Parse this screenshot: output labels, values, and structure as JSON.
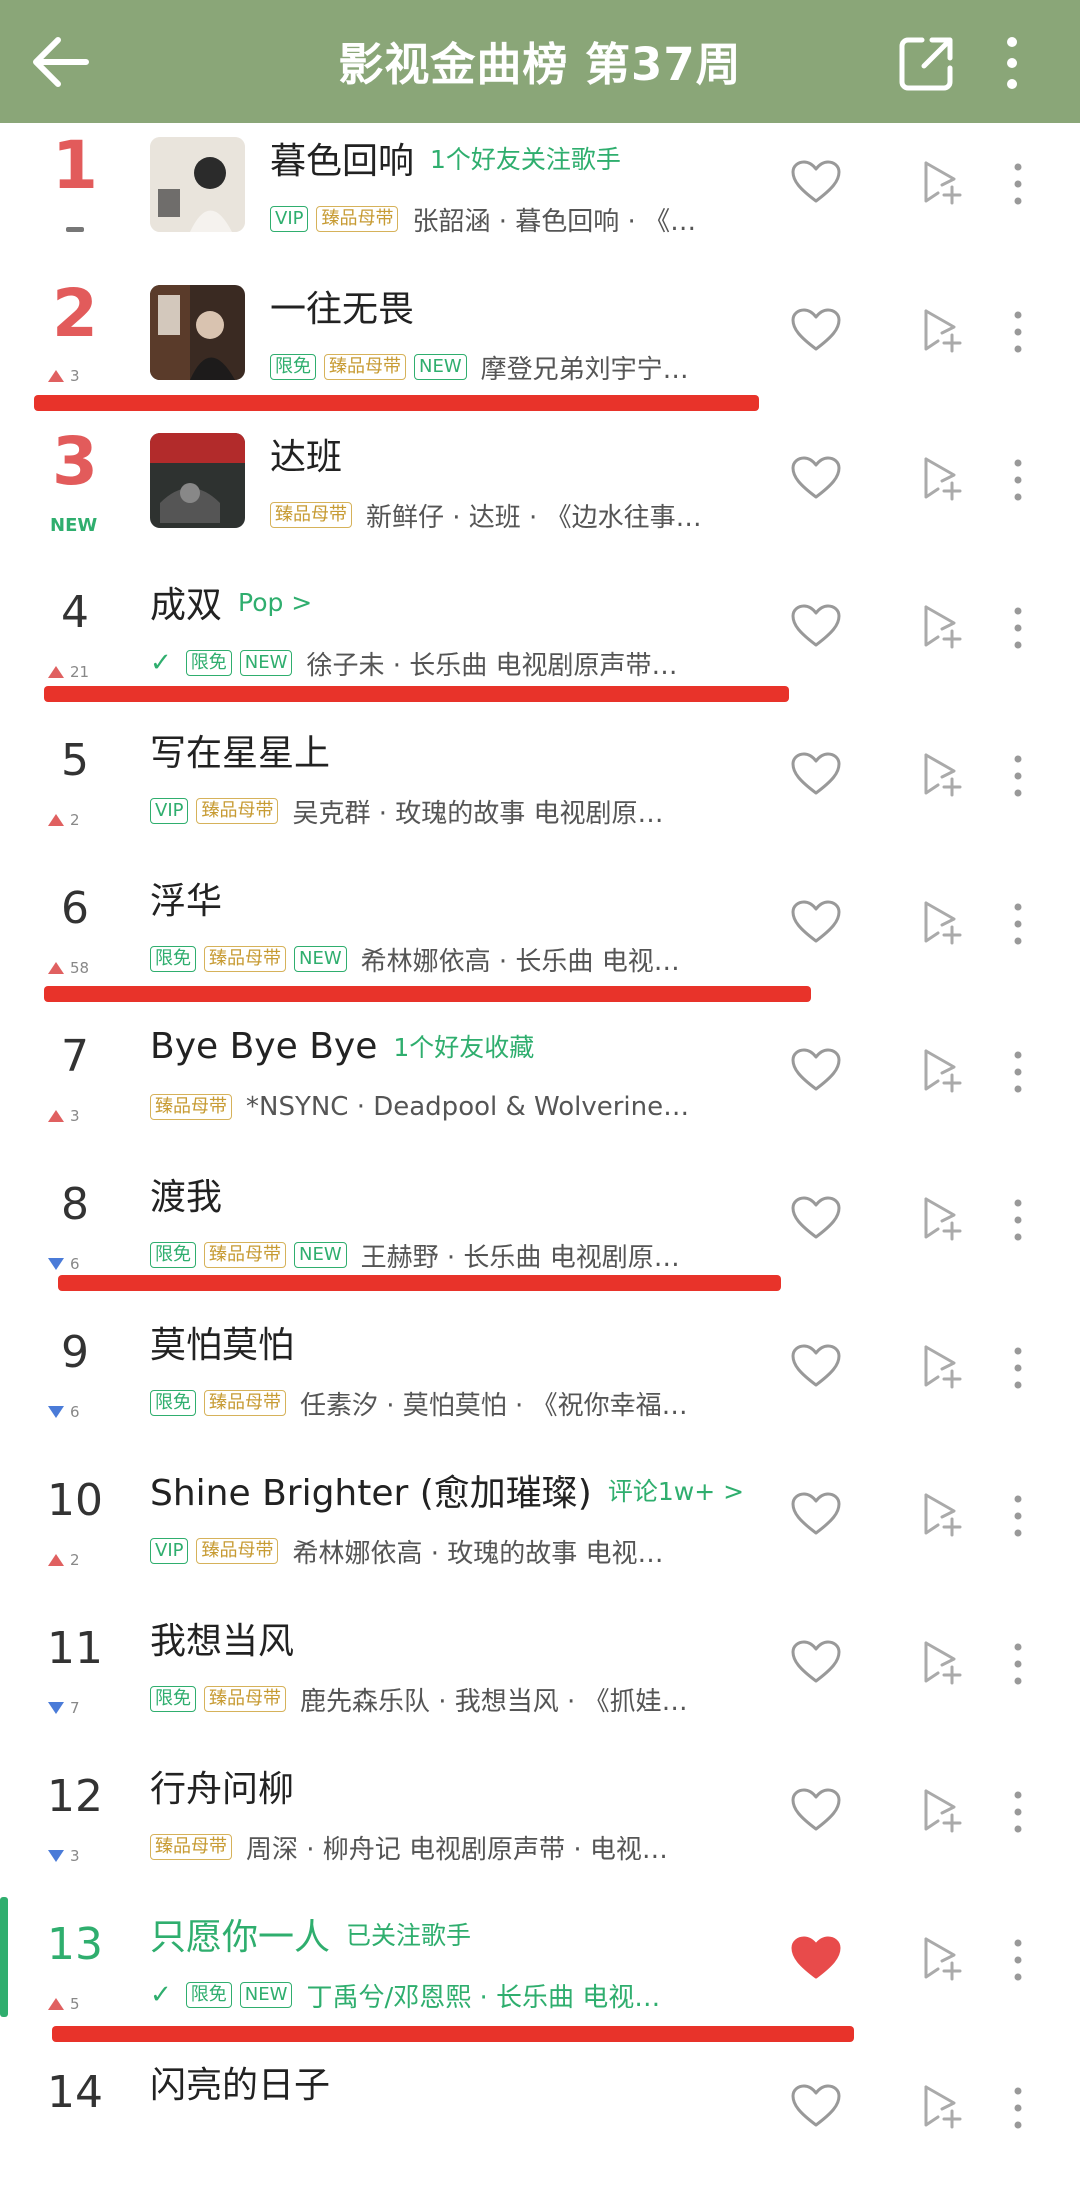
{
  "header": {
    "title": "影视金曲榜 第37周",
    "background_color": "#8aa678"
  },
  "rows": [
    {
      "rank": "1",
      "trend": "same",
      "trend_num": "",
      "title": "暮色回响",
      "tagline": "1个好友关注歌手",
      "badges": [
        "VIP",
        "臻品母带"
      ],
      "meta": "张韶涵 · 暮色回响 · 《…",
      "cover": true,
      "liked": false,
      "highlight": false
    },
    {
      "rank": "2",
      "trend": "up",
      "trend_num": "3",
      "title": "一往无畏",
      "tagline": "",
      "badges": [
        "限免",
        "臻品母带",
        "NEW"
      ],
      "meta": "摩登兄弟刘宇宁…",
      "cover": true,
      "liked": false,
      "highlight": false
    },
    {
      "rank": "3",
      "trend": "new",
      "trend_num": "NEW",
      "title": "达班",
      "tagline": "",
      "badges": [
        "臻品母带"
      ],
      "meta": "新鲜仔 · 达班 · 《边水往事…",
      "cover": true,
      "liked": false,
      "highlight": false
    },
    {
      "rank": "4",
      "trend": "up",
      "trend_num": "21",
      "title": "成双",
      "tagline": "Pop >",
      "badges": [
        "check",
        "限免",
        "NEW"
      ],
      "meta": "徐子未 · 长乐曲 电视剧原声带…",
      "cover": false,
      "liked": false,
      "highlight": false
    },
    {
      "rank": "5",
      "trend": "up",
      "trend_num": "2",
      "title": "写在星星上",
      "tagline": "",
      "badges": [
        "VIP",
        "臻品母带"
      ],
      "meta": "吴克群 · 玫瑰的故事 电视剧原…",
      "cover": false,
      "liked": false,
      "highlight": false
    },
    {
      "rank": "6",
      "trend": "up",
      "trend_num": "58",
      "title": "浮华",
      "tagline": "",
      "badges": [
        "限免",
        "臻品母带",
        "NEW"
      ],
      "meta": "希林娜依高 · 长乐曲 电视…",
      "cover": false,
      "liked": false,
      "highlight": false
    },
    {
      "rank": "7",
      "trend": "up",
      "trend_num": "3",
      "title": "Bye Bye Bye",
      "tagline": "1个好友收藏",
      "badges": [
        "臻品母带"
      ],
      "meta": "*NSYNC · Deadpool & Wolverine…",
      "cover": false,
      "liked": false,
      "highlight": false
    },
    {
      "rank": "8",
      "trend": "down",
      "trend_num": "6",
      "title": "渡我",
      "tagline": "",
      "badges": [
        "限免",
        "臻品母带",
        "NEW"
      ],
      "meta": "王赫野 · 长乐曲 电视剧原…",
      "cover": false,
      "liked": false,
      "highlight": false
    },
    {
      "rank": "9",
      "trend": "down",
      "trend_num": "6",
      "title": "莫怕莫怕",
      "tagline": "",
      "badges": [
        "限免",
        "臻品母带"
      ],
      "meta": "任素汐 · 莫怕莫怕 · 《祝你幸福…",
      "cover": false,
      "liked": false,
      "highlight": false
    },
    {
      "rank": "10",
      "trend": "up",
      "trend_num": "2",
      "title": "Shine Brighter (愈加璀璨)",
      "tagline": "评论1w+ >",
      "badges": [
        "VIP",
        "臻品母带"
      ],
      "meta": "希林娜依高 · 玫瑰的故事 电视…",
      "cover": false,
      "liked": false,
      "highlight": false
    },
    {
      "rank": "11",
      "trend": "down",
      "trend_num": "7",
      "title": "我想当风",
      "tagline": "",
      "badges": [
        "限免",
        "臻品母带"
      ],
      "meta": "鹿先森乐队 · 我想当风 · 《抓娃…",
      "cover": false,
      "liked": false,
      "highlight": false
    },
    {
      "rank": "12",
      "trend": "down",
      "trend_num": "3",
      "title": "行舟问柳",
      "tagline": "",
      "badges": [
        "臻品母带"
      ],
      "meta": "周深 · 柳舟记 电视剧原声带 · 电视…",
      "cover": false,
      "liked": false,
      "highlight": false
    },
    {
      "rank": "13",
      "trend": "up",
      "trend_num": "5",
      "title": "只愿你一人",
      "tagline": "已关注歌手",
      "badges": [
        "check",
        "限免",
        "NEW"
      ],
      "meta": "丁禹兮/邓恩熙 · 长乐曲 电视…",
      "cover": false,
      "liked": true,
      "highlight": true
    },
    {
      "rank": "14",
      "trend": "none",
      "trend_num": "",
      "title": "闪亮的日子",
      "tagline": "",
      "badges": [],
      "meta": "",
      "cover": false,
      "liked": false,
      "highlight": false
    }
  ],
  "colors": {
    "accent": "#2fae6e",
    "rank_top": "#e25b5b",
    "heart_active": "#e84b4b",
    "redline": "#e8332a"
  }
}
